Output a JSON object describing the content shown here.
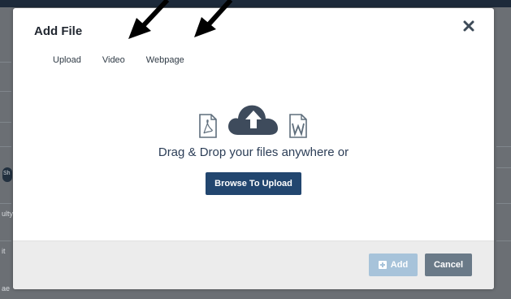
{
  "background": {
    "fragments": [
      "Sh",
      "ulty",
      "it",
      "ae"
    ]
  },
  "modal": {
    "title": "Add File",
    "close_icon": "close-icon",
    "tabs": [
      {
        "label": "Upload"
      },
      {
        "label": "Video"
      },
      {
        "label": "Webpage"
      }
    ],
    "dropzone": {
      "icons": [
        "pdf-file-icon",
        "cloud-upload-icon",
        "word-file-icon"
      ],
      "text": "Drag & Drop your files anywhere or",
      "browse_label": "Browse To Upload"
    },
    "footer": {
      "add_label": "Add",
      "cancel_label": "Cancel"
    }
  },
  "annotations": {
    "arrow_count": 2,
    "arrow_color": "#000000"
  },
  "colors": {
    "primary": "#22466f",
    "disabled_primary": "#a7c3da",
    "secondary": "#6a7a88",
    "text_dark": "#2c3e57"
  }
}
